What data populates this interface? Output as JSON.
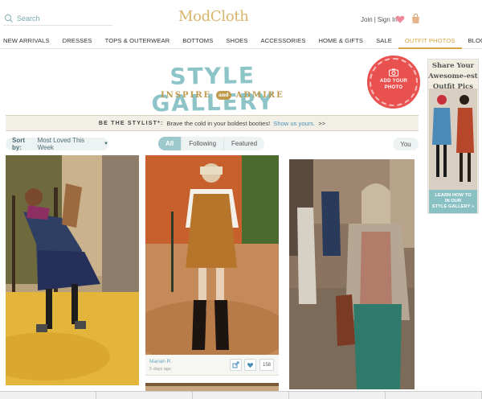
{
  "header": {
    "search_placeholder": "Search",
    "logo": "ModCloth",
    "join_label": "Join",
    "separator": "|",
    "signin_label": "Sign In"
  },
  "nav": [
    "NEW ARRIVALS",
    "DRESSES",
    "TOPS & OUTERWEAR",
    "BOTTOMS",
    "SHOES",
    "ACCESSORIES",
    "HOME & GIFTS",
    "SALE",
    "OUTFIT PHOTOS",
    "BLOG"
  ],
  "nav_active": "OUTFIT PHOTOS",
  "gallery": {
    "title": "STYLE GALLERY",
    "subtitle_left": "INSPIRE",
    "subtitle_and": "and",
    "subtitle_right": "ADMIRE",
    "add_photo_line1": "ADD YOUR",
    "add_photo_line2": "PHOTO"
  },
  "stylist_bar": {
    "label": "BE THE STYLIST*:",
    "text": "Brave the cold in your boldest booties!",
    "link": "Show us yours.",
    "arrows": ">>"
  },
  "filters": {
    "sort_label": "Sort by:",
    "sort_value": "Most Loved This Week",
    "tabs": [
      "All",
      "Following",
      "Featured"
    ],
    "active_tab": "All",
    "you_label": "You"
  },
  "cards": [
    {
      "user": "Mariah R.",
      "time": "5 days ago",
      "likes": "158"
    }
  ],
  "side_promo": {
    "heading_1": "Share Your",
    "heading_2": "Awesome-est",
    "heading_3": "Outfit Pics",
    "cta_1": "LEARN HOW TO",
    "cta_2": "IN OUR",
    "cta_3": "STYLE GALLERY »"
  },
  "colors": {
    "accent_gold": "#d4a643",
    "teal": "#8cc4c8",
    "badge_red": "#e9514f",
    "link_blue": "#4a8fb8"
  },
  "icons": [
    "search-icon",
    "heart-icon",
    "shopping-bag-icon",
    "camera-icon",
    "share-icon",
    "heart-icon",
    "caret-down-icon"
  ]
}
